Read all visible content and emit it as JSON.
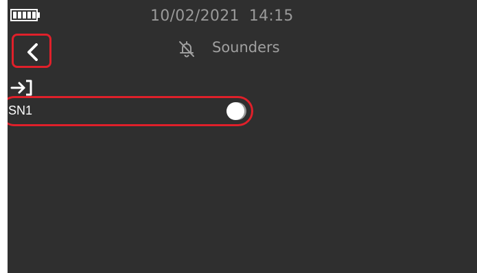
{
  "status_bar": {
    "date": "10/02/2021",
    "time": "14:15",
    "battery_icon": "battery-full-icon"
  },
  "header": {
    "back_icon": "chevron-left-icon",
    "title_icon": "bell-off-icon",
    "title": "Sounders"
  },
  "toolbar": {
    "login_icon": "login-arrow-icon"
  },
  "sounders": [
    {
      "label": "SN1",
      "enabled": true
    }
  ],
  "colors": {
    "screen_background": "#2f2f2f",
    "highlight": "#e0202a",
    "text_muted": "#a0a0a0",
    "text_primary": "#ffffff"
  }
}
